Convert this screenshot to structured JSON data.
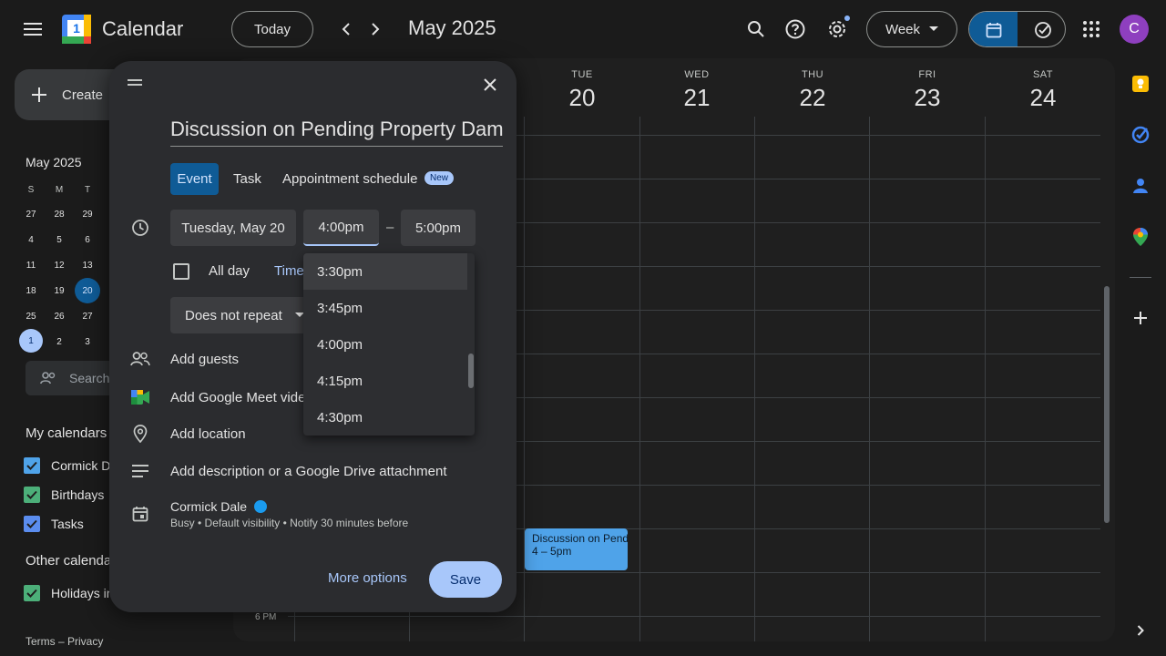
{
  "header": {
    "app_title": "Calendar",
    "logo_day": "1",
    "today_label": "Today",
    "month_title": "May 2025",
    "view_label": "Week",
    "avatar_letter": "C"
  },
  "sidebar": {
    "create_label": "Create",
    "mini_calendar": {
      "title": "May 2025",
      "weekdays": [
        "S",
        "M",
        "T"
      ],
      "weeks": [
        [
          "27",
          "28",
          "29"
        ],
        [
          "4",
          "5",
          "6"
        ],
        [
          "11",
          "12",
          "13"
        ],
        [
          "18",
          "19",
          "20"
        ],
        [
          "25",
          "26",
          "27"
        ],
        [
          "1",
          "2",
          "3"
        ]
      ]
    },
    "search_placeholder": "Search",
    "my_calendars_heading": "My calendars",
    "my_calendars": [
      {
        "label": "Cormick D",
        "color": "#4fa3e9"
      },
      {
        "label": "Birthdays",
        "color": "#4caf79"
      },
      {
        "label": "Tasks",
        "color": "#5b8def"
      }
    ],
    "other_calendars_heading": "Other calenda",
    "other_calendars": [
      {
        "label": "Holidays in",
        "color": "#4caf79"
      }
    ],
    "footer": "Terms – Privacy"
  },
  "week": {
    "days": [
      {
        "name": "TUE",
        "num": "20"
      },
      {
        "name": "WED",
        "num": "21"
      },
      {
        "name": "THU",
        "num": "22"
      },
      {
        "name": "FRI",
        "num": "23"
      },
      {
        "name": "SAT",
        "num": "24"
      }
    ],
    "time_label_6pm": "6 PM",
    "event": {
      "title": "Discussion on Pending",
      "time": "4 – 5pm",
      "color": "#4fa3e9"
    }
  },
  "dialog": {
    "title": "Discussion on Pending Property Dam",
    "tabs": {
      "event": "Event",
      "task": "Task",
      "appointment": "Appointment schedule",
      "new_badge": "New"
    },
    "date": "Tuesday, May 20",
    "start_time": "4:00pm",
    "dash": "–",
    "end_time": "5:00pm",
    "all_day": "All day",
    "time_zone_partial": "Time",
    "repeat": "Does not repeat",
    "add_guests": "Add guests",
    "add_meet": "Add Google Meet video",
    "add_location": "Add location",
    "add_description": "Add description or a Google Drive attachment",
    "owner_name": "Cormick Dale",
    "owner_details": "Busy • Default visibility • Notify 30 minutes before",
    "more_options": "More options",
    "save": "Save"
  },
  "time_dropdown": {
    "options": [
      "3:30pm",
      "3:45pm",
      "4:00pm",
      "4:15pm",
      "4:30pm"
    ]
  }
}
